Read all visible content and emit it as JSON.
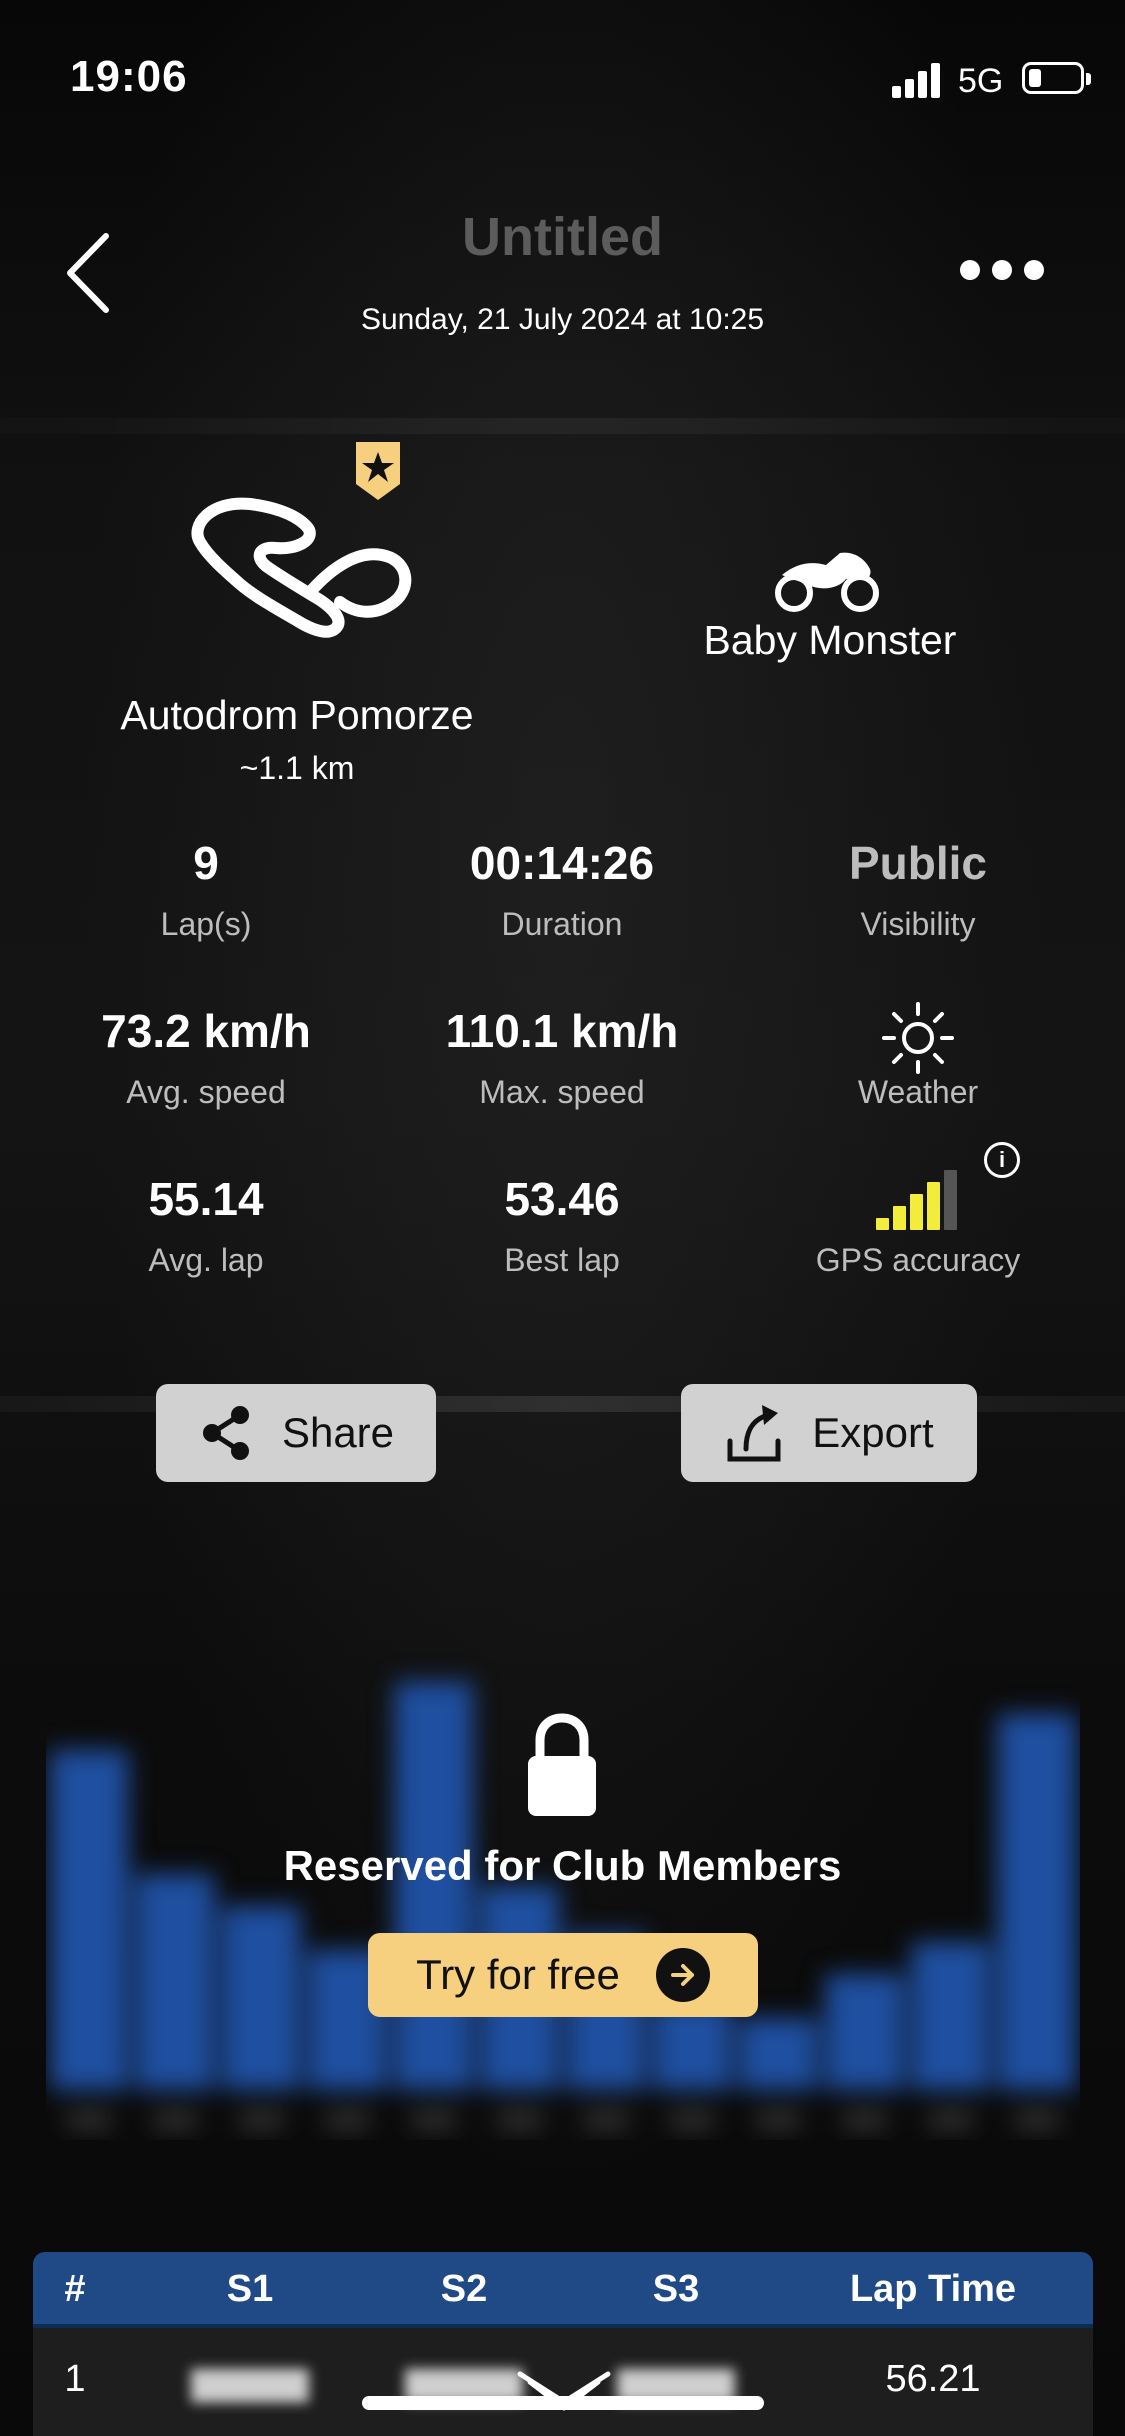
{
  "status_bar": {
    "time": "19:06",
    "network": "5G"
  },
  "header": {
    "title": "Untitled",
    "subtitle": "Sunday, 21 July 2024 at 10:25"
  },
  "track": {
    "name": "Autodrom Pomorze",
    "length": "~1.1 km"
  },
  "bike": {
    "name": "Baby Monster"
  },
  "stats": {
    "laps": {
      "value": "9",
      "label": "Lap(s)"
    },
    "duration": {
      "value": "00:14:26",
      "label": "Duration"
    },
    "visibility": {
      "value": "Public",
      "label": "Visibility"
    },
    "avg_speed": {
      "value": "73.2 km/h",
      "label": "Avg. speed"
    },
    "max_speed": {
      "value": "110.1 km/h",
      "label": "Max. speed"
    },
    "weather": {
      "label": "Weather",
      "icon": "sun-icon"
    },
    "avg_lap": {
      "value": "55.14",
      "label": "Avg. lap"
    },
    "best_lap": {
      "value": "53.46",
      "label": "Best lap"
    },
    "gps": {
      "label": "GPS accuracy",
      "bars_filled": 4,
      "bars_total": 5
    }
  },
  "actions": {
    "share_label": "Share",
    "export_label": "Export"
  },
  "locked_section": {
    "message": "Reserved for Club Members",
    "cta_label": "Try for free",
    "accent_color": "#f6cf7f",
    "chart_color": "#1f4fa0"
  },
  "chart_data": {
    "type": "bar",
    "values": [
      8.5,
      5.4,
      4.6,
      3.5,
      10.2,
      5.1,
      3.9,
      2.2,
      1.8,
      2.9,
      3.7,
      9.4
    ],
    "ylim": [
      0,
      11
    ]
  },
  "laps_table": {
    "columns": [
      "#",
      "S1",
      "S2",
      "S3",
      "Lap Time"
    ],
    "rows": [
      {
        "num": "1",
        "lap_time": "56.21"
      }
    ]
  },
  "colors": {
    "table_header": "#1f4a86",
    "button_bg": "#d1d1d1",
    "gps_bar": "#f4ec3b"
  }
}
